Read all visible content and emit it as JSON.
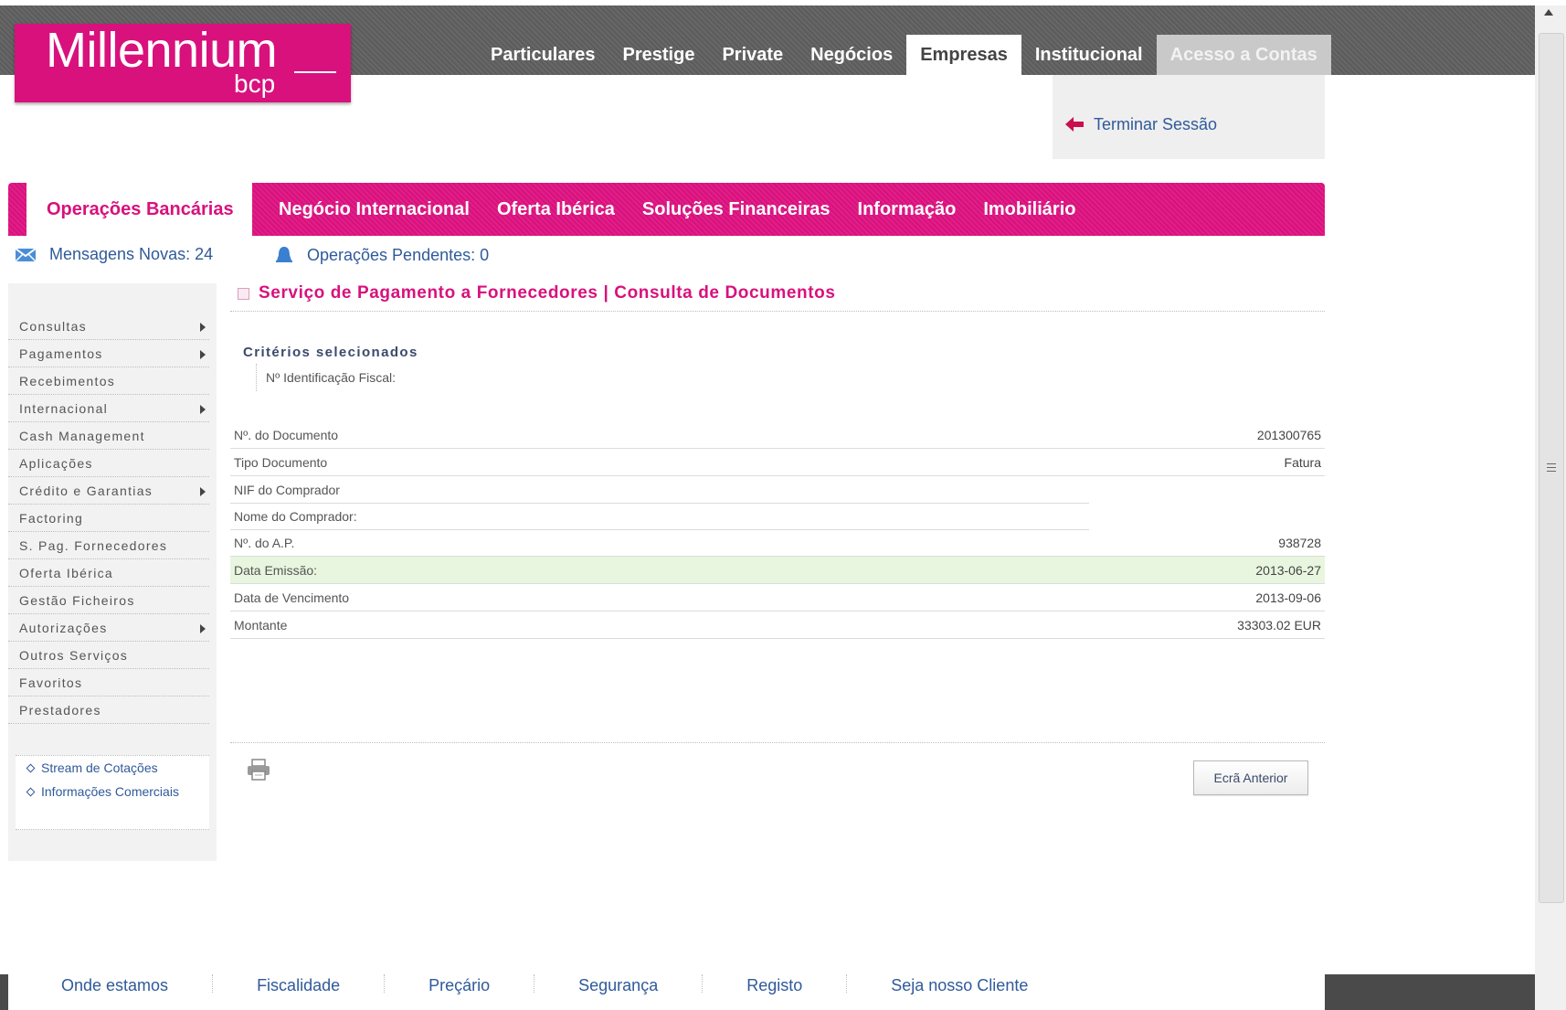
{
  "brand": {
    "name": "Millennium",
    "sub": "bcp"
  },
  "top_nav": {
    "items": [
      "Particulares",
      "Prestige",
      "Private",
      "Negócios",
      "Empresas",
      "Institucional"
    ],
    "active": "Empresas",
    "access": "Acesso a Contas"
  },
  "session": {
    "logout": "Terminar Sessão"
  },
  "main_nav": {
    "active": "Operações Bancárias",
    "tabs": [
      "Negócio Internacional",
      "Oferta Ibérica",
      "Soluções Financeiras",
      "Informação",
      "Imobiliário"
    ]
  },
  "status": {
    "messages": "Mensagens Novas: 24",
    "pending": "Operações Pendentes: 0"
  },
  "sidebar": {
    "items": [
      {
        "label": "Consultas",
        "submenu": true
      },
      {
        "label": "Pagamentos",
        "submenu": true
      },
      {
        "label": "Recebimentos",
        "submenu": false
      },
      {
        "label": "Internacional",
        "submenu": true
      },
      {
        "label": "Cash Management",
        "submenu": false
      },
      {
        "label": "Aplicações",
        "submenu": false
      },
      {
        "label": "Crédito e Garantias",
        "submenu": true
      },
      {
        "label": "Factoring",
        "submenu": false
      },
      {
        "label": "S. Pag. Fornecedores",
        "submenu": false
      },
      {
        "label": "Oferta Ibérica",
        "submenu": false
      },
      {
        "label": "Gestão Ficheiros",
        "submenu": false
      },
      {
        "label": "Autorizações",
        "submenu": true
      },
      {
        "label": "Outros Serviços",
        "submenu": false
      },
      {
        "label": "Favoritos",
        "submenu": false
      },
      {
        "label": "Prestadores",
        "submenu": false
      }
    ],
    "links": [
      "Stream de Cotações",
      "Informações Comerciais"
    ]
  },
  "page": {
    "title": "Serviço de Pagamento a Fornecedores | Consulta de Documentos",
    "criteria_heading": "Critérios selecionados",
    "criteria": [
      "Nº Identificação Fiscal:"
    ]
  },
  "document": {
    "rows": [
      {
        "label": "Nº. do Documento",
        "value": "201300765"
      },
      {
        "label": "Tipo Documento",
        "value": "Fatura"
      },
      {
        "label": "NIF do Comprador",
        "value": ""
      },
      {
        "label": "Nome do Comprador:",
        "value": ""
      },
      {
        "label": "Nº. do A.P.",
        "value": "938728"
      },
      {
        "label": "Data Emissão:",
        "value": "2013-06-27"
      },
      {
        "label": "Data de Vencimento",
        "value": "2013-09-06"
      },
      {
        "label": "Montante",
        "value": "33303.02 EUR"
      }
    ]
  },
  "actions": {
    "back": "Ecrã Anterior"
  },
  "footer": {
    "links": [
      "Onde estamos",
      "Fiscalidade",
      "Preçário",
      "Segurança",
      "Registo",
      "Seja nosso Cliente"
    ]
  },
  "colors": {
    "brand_pink": "#d8117d",
    "link_blue": "#2f5a9a",
    "highlight_row": "#e8f5df"
  }
}
